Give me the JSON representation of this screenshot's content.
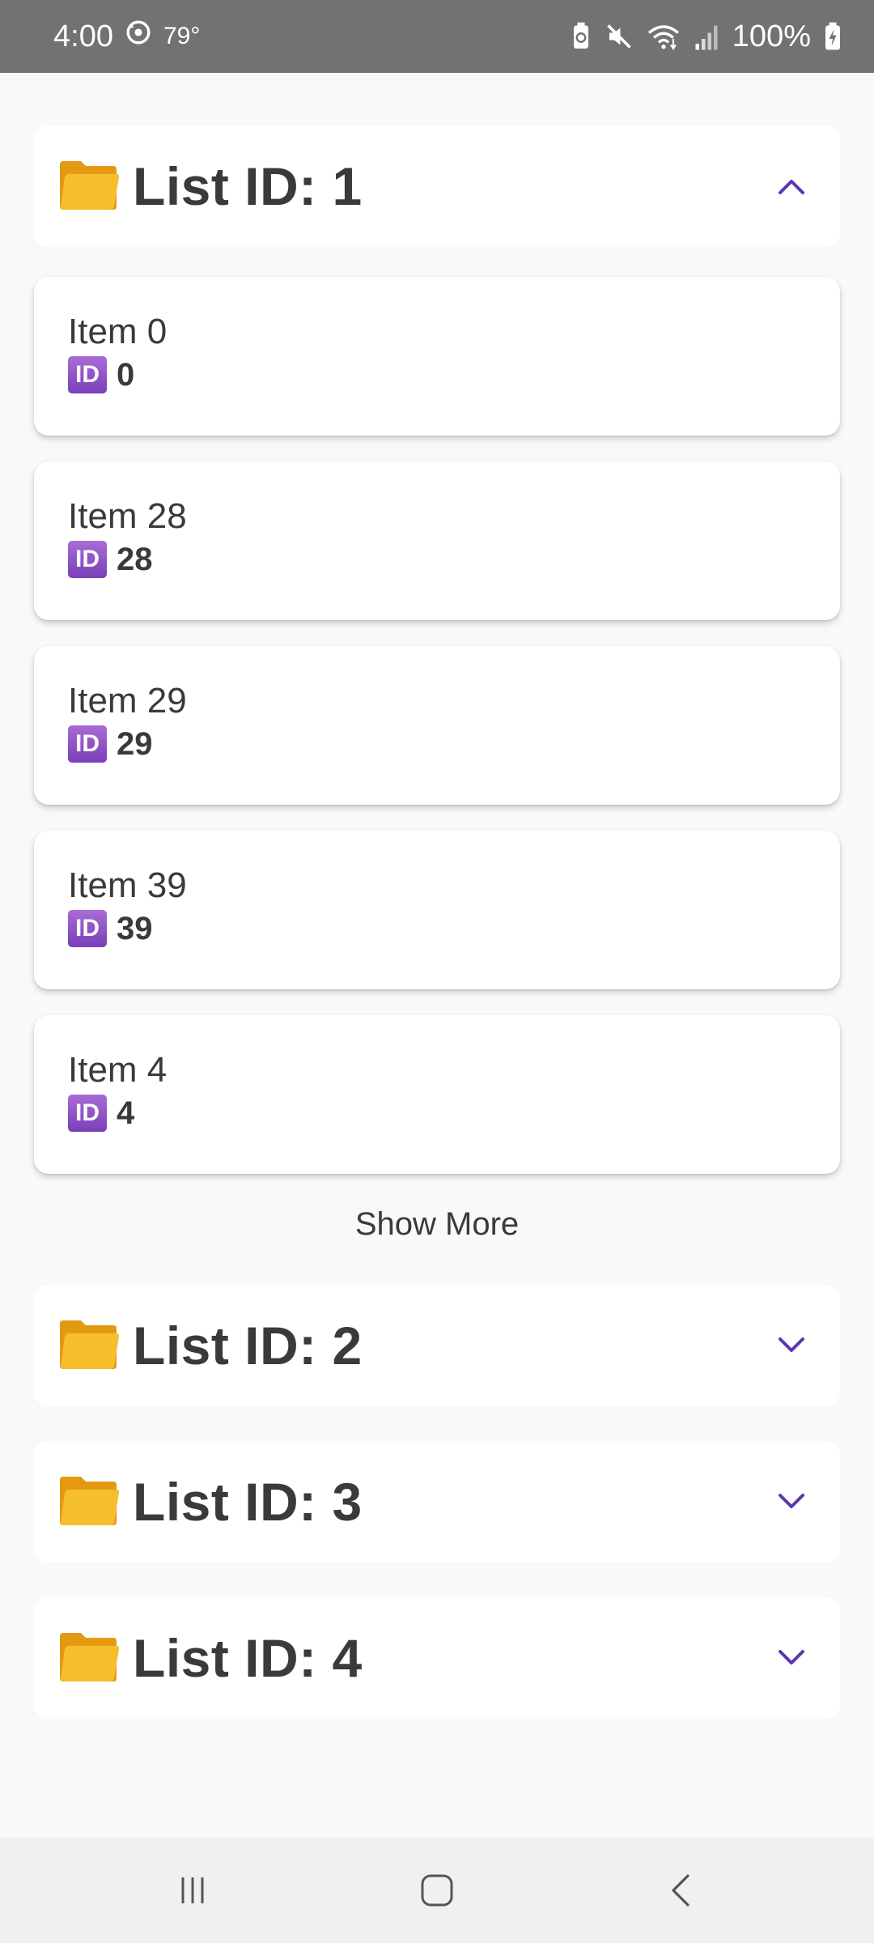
{
  "status_bar": {
    "time": "4:00",
    "temperature": "79°",
    "battery": "100%",
    "icons": [
      "sync-icon",
      "battery-saver-icon",
      "mute-icon",
      "wifi-icon",
      "signal-icon",
      "battery-charging-icon"
    ]
  },
  "lists": [
    {
      "title": "List ID: 1",
      "expanded": true,
      "items": [
        {
          "name": "Item 0",
          "id": "0"
        },
        {
          "name": "Item 28",
          "id": "28"
        },
        {
          "name": "Item 29",
          "id": "29"
        },
        {
          "name": "Item 39",
          "id": "39"
        },
        {
          "name": "Item 4",
          "id": "4"
        }
      ],
      "show_more_label": "Show More"
    },
    {
      "title": "List ID: 2",
      "expanded": false
    },
    {
      "title": "List ID: 3",
      "expanded": false
    },
    {
      "title": "List ID: 4",
      "expanded": false
    }
  ],
  "id_badge_label": "ID",
  "colors": {
    "accent": "#5e35b1",
    "status_bar": "#727272",
    "background": "#f9f9f9",
    "card": "#ffffff",
    "text": "#3a3a3a"
  },
  "nav_bar": {
    "icons": [
      "recents-icon",
      "home-icon",
      "back-icon"
    ]
  }
}
